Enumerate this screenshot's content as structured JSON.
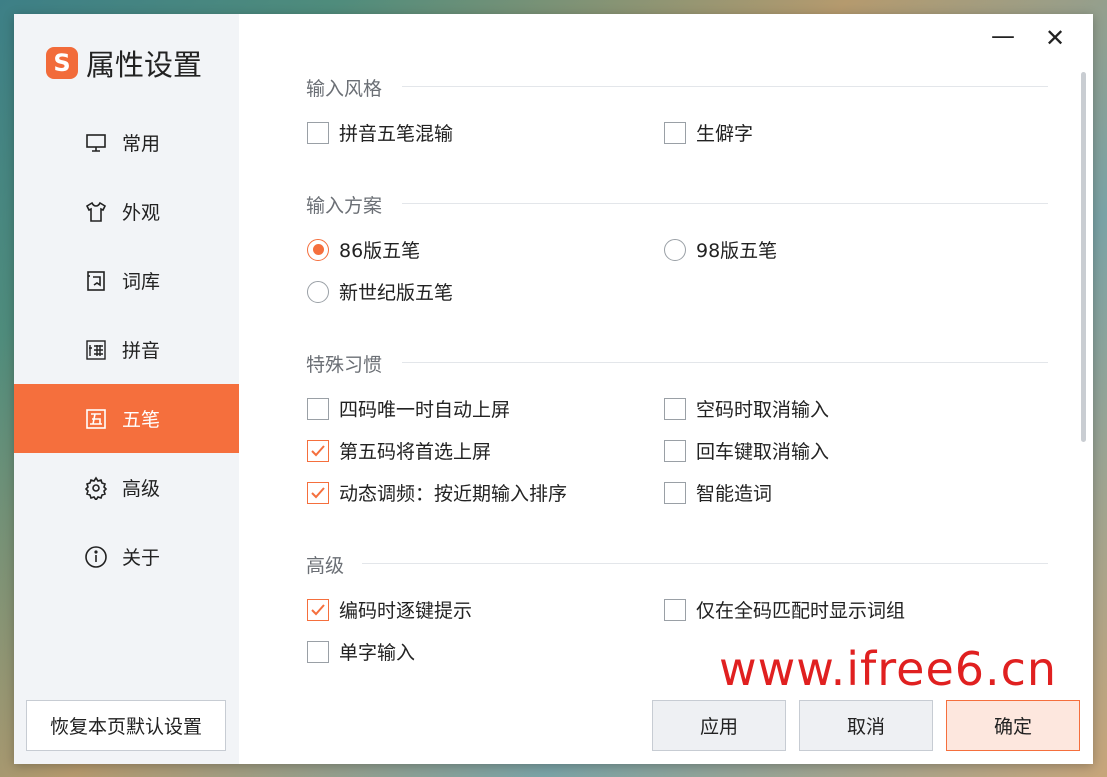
{
  "app": {
    "title": "属性设置",
    "logo_letter": "S"
  },
  "sidebar": {
    "items": [
      {
        "label": "常用",
        "icon": "monitor-icon"
      },
      {
        "label": "外观",
        "icon": "shirt-icon"
      },
      {
        "label": "词库",
        "icon": "book-icon"
      },
      {
        "label": "拼音",
        "icon": "pinyin-icon"
      },
      {
        "label": "五笔",
        "icon": "wubi-icon",
        "active": true
      },
      {
        "label": "高级",
        "icon": "gear-icon"
      },
      {
        "label": "关于",
        "icon": "info-icon"
      }
    ],
    "reset_label": "恢复本页默认设置"
  },
  "window": {
    "minimize_glyph": "—",
    "close_glyph": "✕"
  },
  "sections": {
    "style": {
      "title": "输入风格",
      "options": [
        {
          "label": "拼音五笔混输",
          "checked": false
        },
        {
          "label": "生僻字",
          "checked": false
        }
      ]
    },
    "scheme": {
      "title": "输入方案",
      "options": [
        {
          "label": "86版五笔",
          "selected": true
        },
        {
          "label": "98版五笔",
          "selected": false
        },
        {
          "label": "新世纪版五笔",
          "selected": false
        }
      ]
    },
    "habits": {
      "title": "特殊习惯",
      "options": [
        {
          "label": "四码唯一时自动上屏",
          "checked": false
        },
        {
          "label": "空码时取消输入",
          "checked": false
        },
        {
          "label": "第五码将首选上屏",
          "checked": true
        },
        {
          "label": "回车键取消输入",
          "checked": false
        },
        {
          "label": "动态调频：按近期输入排序",
          "checked": true
        },
        {
          "label": "智能造词",
          "checked": false
        }
      ]
    },
    "advanced": {
      "title": "高级",
      "options": [
        {
          "label": "编码时逐键提示",
          "checked": true
        },
        {
          "label": "仅在全码匹配时显示词组",
          "checked": false
        },
        {
          "label": "单字输入",
          "checked": false
        }
      ]
    }
  },
  "buttons": {
    "apply": "应用",
    "cancel": "取消",
    "ok": "确定"
  },
  "watermark": "www.ifree6.cn",
  "colors": {
    "accent": "#f56f3d",
    "sidebar_bg": "#f2f4f7"
  }
}
